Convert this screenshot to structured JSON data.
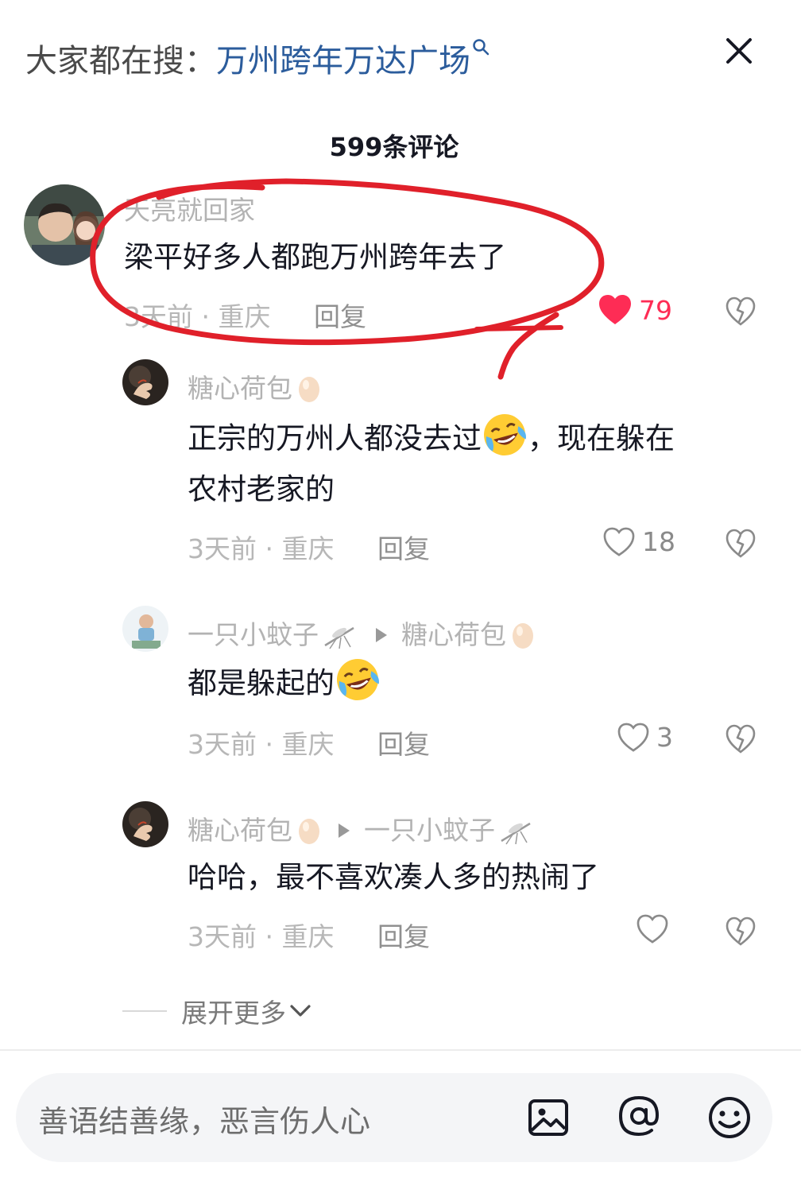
{
  "search": {
    "prefix": "大家都在搜：",
    "keyword": "万州跨年万达广场"
  },
  "comment_count": "599条评论",
  "comments": [
    {
      "author": "天亮就回家",
      "content": "梁平好多人都跑万州跨年去了",
      "time": "3天前",
      "location": "重庆",
      "reply": "回复",
      "likes": "79",
      "liked": true
    },
    {
      "author": "糖心荷包",
      "content_a": "正宗的万州人都没去过",
      "content_b": "，现在躲在",
      "content_c": "农村老家的",
      "time": "3天前",
      "location": "重庆",
      "reply": "回复",
      "likes": "18"
    },
    {
      "author": "一只小蚊子",
      "reply_to": "糖心荷包",
      "content": "都是躲起的",
      "time": "3天前",
      "location": "重庆",
      "reply": "回复",
      "likes": "3"
    },
    {
      "author": "糖心荷包",
      "reply_to": "一只小蚊子",
      "content": "哈哈，最不喜欢凑人多的热闹了",
      "time": "3天前",
      "location": "重庆",
      "reply": "回复",
      "likes": ""
    }
  ],
  "expand_more": "展开更多",
  "input": {
    "placeholder": "善语结善缘，恶言伤人心"
  },
  "colors": {
    "like_active": "#fe2c55",
    "annotation": "#e0202a",
    "keyword": "#2b5c9c"
  },
  "icons": [
    "search-icon",
    "close-icon",
    "heart-icon",
    "broken-heart-icon",
    "laugh-cry-emoji",
    "egg-icon",
    "mosquito-icon",
    "reply-arrow-icon",
    "chevron-down-icon",
    "image-icon",
    "at-icon",
    "smiley-icon"
  ]
}
